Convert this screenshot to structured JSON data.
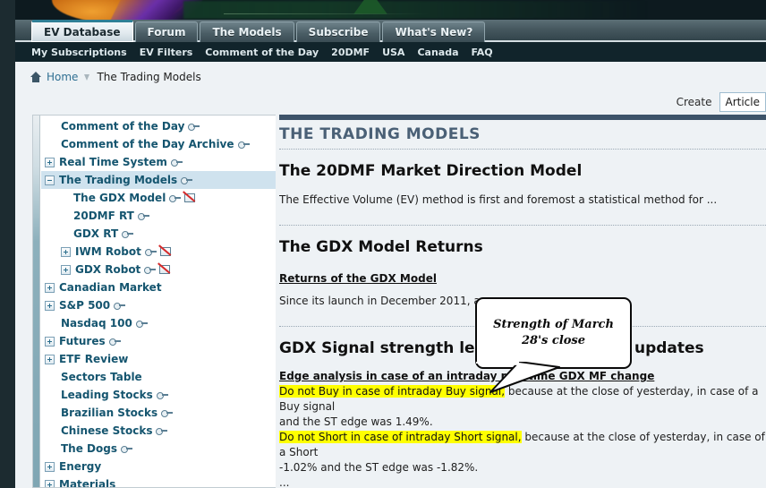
{
  "banner": {
    "alt": "site-banner-artwork"
  },
  "tabs": [
    {
      "label": "EV Database",
      "active": true
    },
    {
      "label": "Forum",
      "active": false
    },
    {
      "label": "The Models",
      "active": false
    },
    {
      "label": "Subscribe",
      "active": false
    },
    {
      "label": "What's New?",
      "active": false
    }
  ],
  "subnav": [
    "My Subscriptions",
    "EV Filters",
    "Comment of the Day",
    "20DMF",
    "USA",
    "Canada",
    "FAQ"
  ],
  "breadcrumb": {
    "home": "Home",
    "current": "The Trading Models"
  },
  "create": {
    "label": "Create",
    "selected": "Article"
  },
  "sidebar": {
    "items": [
      {
        "label": "Comment of the Day",
        "indent": 1,
        "toggle": "none",
        "key": true,
        "book": false,
        "selected": false
      },
      {
        "label": "Comment of the Day Archive",
        "indent": 1,
        "toggle": "none",
        "key": true,
        "book": false,
        "selected": false
      },
      {
        "label": "Real Time System",
        "indent": 0,
        "toggle": "plus",
        "key": true,
        "book": false,
        "selected": false
      },
      {
        "label": "The Trading Models",
        "indent": 0,
        "toggle": "minus",
        "key": true,
        "book": false,
        "selected": true
      },
      {
        "label": "The GDX Model",
        "indent": 2,
        "toggle": "none",
        "key": true,
        "book": true,
        "selected": false
      },
      {
        "label": "20DMF RT",
        "indent": 2,
        "toggle": "none",
        "key": true,
        "book": false,
        "selected": false
      },
      {
        "label": "GDX RT",
        "indent": 2,
        "toggle": "none",
        "key": true,
        "book": false,
        "selected": false
      },
      {
        "label": "IWM Robot",
        "indent": 1,
        "toggle": "plus",
        "key": true,
        "book": true,
        "selected": false
      },
      {
        "label": "GDX Robot",
        "indent": 1,
        "toggle": "plus",
        "key": true,
        "book": true,
        "selected": false
      },
      {
        "label": "Canadian Market",
        "indent": 0,
        "toggle": "plus",
        "key": false,
        "book": false,
        "selected": false
      },
      {
        "label": "S&P 500",
        "indent": 0,
        "toggle": "plus",
        "key": true,
        "book": false,
        "selected": false
      },
      {
        "label": "Nasdaq 100",
        "indent": 1,
        "toggle": "none",
        "key": true,
        "book": false,
        "selected": false
      },
      {
        "label": "Futures",
        "indent": 0,
        "toggle": "plus",
        "key": true,
        "book": false,
        "selected": false
      },
      {
        "label": "ETF Review",
        "indent": 0,
        "toggle": "plus",
        "key": false,
        "book": false,
        "selected": false
      },
      {
        "label": "Sectors Table",
        "indent": 1,
        "toggle": "none",
        "key": false,
        "book": false,
        "selected": false
      },
      {
        "label": "Leading Stocks",
        "indent": 1,
        "toggle": "none",
        "key": true,
        "book": false,
        "selected": false
      },
      {
        "label": "Brazilian Stocks",
        "indent": 1,
        "toggle": "none",
        "key": true,
        "book": false,
        "selected": false
      },
      {
        "label": "Chinese Stocks",
        "indent": 1,
        "toggle": "none",
        "key": true,
        "book": false,
        "selected": false
      },
      {
        "label": "The Dogs",
        "indent": 1,
        "toggle": "none",
        "key": true,
        "book": false,
        "selected": false
      },
      {
        "label": "Energy",
        "indent": 0,
        "toggle": "plus",
        "key": false,
        "book": false,
        "selected": false
      },
      {
        "label": "Materials",
        "indent": 0,
        "toggle": "plus",
        "key": false,
        "book": false,
        "selected": false
      }
    ]
  },
  "content": {
    "page_heading": "THE TRADING MODELS",
    "article1_title": "The 20DMF Market Direction Model",
    "article1_body": "The Effective Volume (EV) method is first and foremost a statistical method for ...",
    "article2_title": "The GDX Model Returns",
    "article2_link": "Returns of the GDX Model",
    "article2_body": "Since its launch in December 2011, as ...",
    "article3_title": "GDX Signal strength levels and real time updates",
    "article3_sub": "Edge analysis in case of an intraday real time GDX MF change",
    "line1_hl": "Do not Buy in case of intraday Buy signal,",
    "line1_rest": " because at the close of yesterday, in case of a Buy signal",
    "line1_cont": "and the ST edge was 1.49%.",
    "line2_hl": "Do not Short in case of intraday Short signal,",
    "line2_rest": " because at the close of yesterday, in case of a Short",
    "line2_cont": "-1.02% and the ST edge was -1.82%.",
    "ellipsis": "..."
  },
  "callout": {
    "text": "Strength of March 28's close"
  },
  "colors": {
    "highlight": "#ffff00",
    "nav_text": "#15556f",
    "selected_row": "#cfe2ee",
    "heading": "#4a6076",
    "page_bg": "#eef2f5",
    "rail": "#1c2b30",
    "subnav_bg": "#11242b"
  }
}
